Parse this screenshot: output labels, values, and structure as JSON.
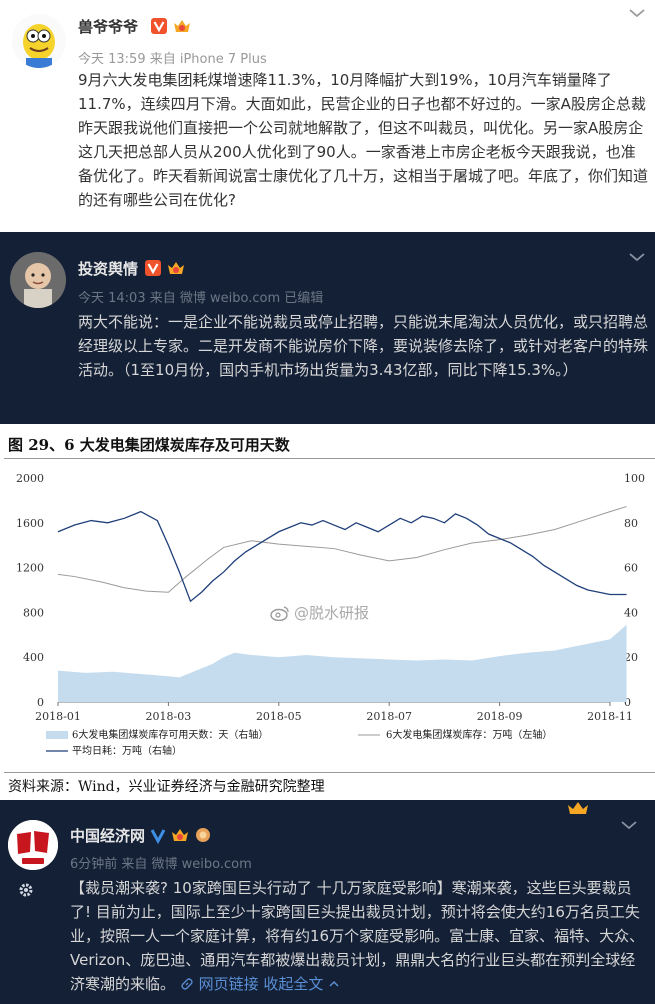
{
  "post1": {
    "username": "兽爷爷爷",
    "meta": "今天 13:59 来自 iPhone 7 Plus",
    "body": "9月六大发电集团耗煤增速降11.3%，10月降幅扩大到19%，10月汽车销量降了11.7%，连续四月下滑。大面如此，民营企业的日子也都不好过的。一家A股房企总裁昨天跟我说他们直接把一个公司就地解散了，但这不叫裁员，叫优化。另一家A股房企这几天把总部人员从200人优化到了90人。一家香港上市房企老板今天跟我说，也准备优化了。昨天看新闻说富士康优化了几十万，这相当于屠城了吧。年底了，你们知道的还有哪些公司在优化?"
  },
  "post2": {
    "username": "投资舆情",
    "meta": "今天 14:03 来自 微博 weibo.com   已编辑",
    "body": "两大不能说：一是企业不能说裁员或停止招聘，只能说末尾淘汰人员优化，或只招聘总经理级以上专家。二是开发商不能说房价下降，要说装修去除了，或针对老客户的特殊活动。（1至10月份，国内手机市场出货量为3.43亿部，同比下降15.3%。）"
  },
  "figure": {
    "title": "图 29、6 大发电集团煤炭库存及可用天数",
    "source": "资料来源：Wind，兴业证券经济与金融研究院整理",
    "watermark": "@脱水研报"
  },
  "chart_data": {
    "type": "line",
    "x_ticks": [
      "2018-01",
      "2018-03",
      "2018-05",
      "2018-07",
      "2018-09",
      "2018-11"
    ],
    "y_left_ticks": [
      "0",
      "400",
      "800",
      "1200",
      "1600",
      "2000"
    ],
    "y_right_ticks": [
      "0",
      "20",
      "40",
      "60",
      "80",
      "100"
    ],
    "ylim_left": [
      0,
      2000
    ],
    "ylim_right": [
      0,
      100
    ],
    "legend": [
      "6大发电集团煤炭库存可用天数：天（右轴）",
      "6大发电集团煤炭库存：万吨（左轴）",
      "平均日耗：万吨（右轴）"
    ],
    "legend_placement": "bottom",
    "colors": {
      "area": "#c5dcee",
      "stock": "#9a9a9a",
      "consumption": "#1f3f7a"
    },
    "series": [
      {
        "name": "6大发电集团煤炭库存可用天数：天（右轴）",
        "axis": "right",
        "kind": "area",
        "x": [
          0,
          0.5,
          1,
          1.5,
          2,
          2.2,
          2.5,
          2.8,
          3,
          3.2,
          3.5,
          4,
          4.5,
          5,
          5.5,
          6,
          6.5,
          7,
          7.5,
          8,
          8.5,
          9,
          9.5,
          10,
          10.3
        ],
        "y": [
          14,
          13,
          13.5,
          12.5,
          11.5,
          11,
          14,
          17,
          20,
          22,
          21,
          20,
          21,
          20,
          19.5,
          19,
          18.5,
          19,
          18.5,
          20.5,
          22,
          23,
          25.5,
          28,
          34.5
        ]
      },
      {
        "name": "6大发电集团煤炭库存：万吨（左轴）",
        "axis": "left",
        "kind": "line",
        "x": [
          0,
          0.3,
          0.8,
          1.2,
          1.6,
          2,
          2.3,
          2.7,
          3,
          3.5,
          4,
          4.5,
          5,
          5.5,
          6,
          6.5,
          7,
          7.5,
          8,
          8.5,
          9,
          9.5,
          10,
          10.3
        ],
        "y": [
          1140,
          1120,
          1070,
          1020,
          990,
          980,
          1110,
          1270,
          1380,
          1440,
          1410,
          1390,
          1370,
          1310,
          1260,
          1290,
          1360,
          1420,
          1450,
          1490,
          1540,
          1620,
          1700,
          1745
        ]
      },
      {
        "name": "平均日耗：万吨（右轴）",
        "axis": "right",
        "kind": "line",
        "x": [
          0,
          0.3,
          0.6,
          0.9,
          1.2,
          1.5,
          1.8,
          2.0,
          2.2,
          2.4,
          2.6,
          2.8,
          3.0,
          3.2,
          3.4,
          3.6,
          3.8,
          4.0,
          4.2,
          4.4,
          4.6,
          4.8,
          5.0,
          5.2,
          5.4,
          5.6,
          5.8,
          6.0,
          6.2,
          6.4,
          6.6,
          6.8,
          7.0,
          7.2,
          7.4,
          7.6,
          7.8,
          8.0,
          8.2,
          8.4,
          8.6,
          8.8,
          9.0,
          9.2,
          9.4,
          9.6,
          9.8,
          10.0,
          10.3
        ],
        "y": [
          76,
          79,
          81,
          80,
          82,
          85,
          81,
          70,
          58,
          45,
          49,
          54,
          58,
          63,
          67,
          70,
          73,
          76,
          78,
          80,
          79,
          81,
          79,
          77,
          80,
          78,
          76,
          79,
          82,
          80,
          83,
          82,
          80,
          84,
          82,
          79,
          75,
          73,
          71,
          68,
          65,
          61,
          58,
          55,
          52,
          50,
          49,
          48,
          48
        ]
      }
    ]
  },
  "post3": {
    "username": "中国经济网",
    "meta": "6分钟前 来自 微博 weibo.com",
    "body": "【裁员潮来袭? 10家跨国巨头行动了 十几万家庭受影响】寒潮来袭，这些巨头要裁员了! 目前为止，国际上至少十家跨国巨头提出裁员计划，预计将会使大约16万名员工失业，按照一人一个家庭计算，将有约16万个家庭受影响。富士康、宜家、福特、大众、Verizon、庞巴迪、通用汽车都被爆出裁员计划，鼎鼎大名的行业巨头都在预判全球经济寒潮的来临。",
    "link": "网页链接",
    "expand": "收起全文"
  }
}
